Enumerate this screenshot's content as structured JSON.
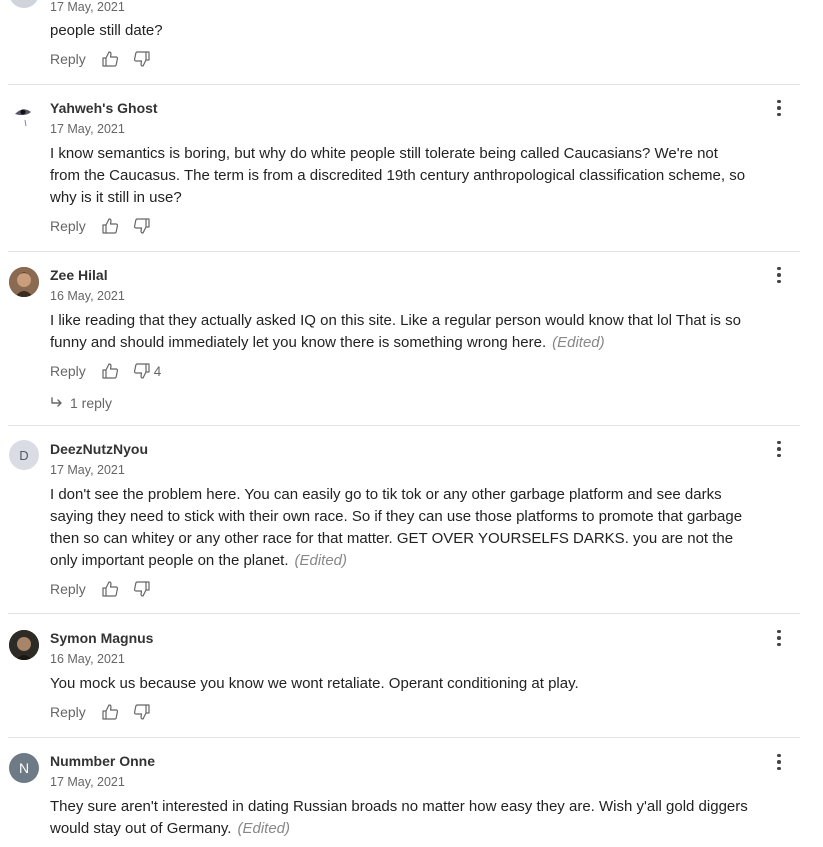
{
  "ui": {
    "reply_label": "Reply"
  },
  "comments": [
    {
      "author": "",
      "date": "17 May, 2021",
      "text": "people still date?",
      "edited": "",
      "dislike_count": ""
    },
    {
      "author": "Yahweh's Ghost",
      "date": "17 May, 2021",
      "text": "I know semantics is boring, but why do white people still tolerate being called Caucasians? We're not from the Caucasus. The term is from a discredited 19th century anthropological classification scheme, so why is it still in use?",
      "edited": "",
      "dislike_count": ""
    },
    {
      "author": "Zee Hilal",
      "date": "16 May, 2021",
      "text": "I like reading that they actually asked IQ on this site. Like a regular person would know that lol That is so funny and should immediately let you know there is something wrong here.",
      "edited": "(Edited)",
      "dislike_count": "4",
      "replies_label": "1 reply"
    },
    {
      "author": "DeezNutzNyou",
      "avatar_letter": "D",
      "date": "17 May, 2021",
      "text": "I don't see the problem here. You can easily go to tik tok or any other garbage platform and see darks saying they need to stick with their own race.  So if they can use those platforms to promote that garbage then so can whitey or any other race for that matter. GET OVER YOURSELFS DARKS. you are not the only important people on the planet.",
      "edited": "(Edited)",
      "dislike_count": ""
    },
    {
      "author": "Symon Magnus",
      "date": "16 May, 2021",
      "text": "You mock us because you know we wont retaliate. Operant conditioning at play.",
      "edited": "",
      "dislike_count": ""
    },
    {
      "author": "Nummber Onne",
      "avatar_letter": "N",
      "date": "17 May, 2021",
      "text": "They sure aren't interested in dating Russian broads no matter how easy they are.  Wish y'all gold diggers would stay out of Germany.",
      "edited": "(Edited)",
      "dislike_count": ""
    }
  ],
  "colors": {
    "avatar_d": "#d9dde3",
    "avatar_n": "#6e7b86",
    "separator": "#e3e3e3",
    "muted": "#666666"
  }
}
